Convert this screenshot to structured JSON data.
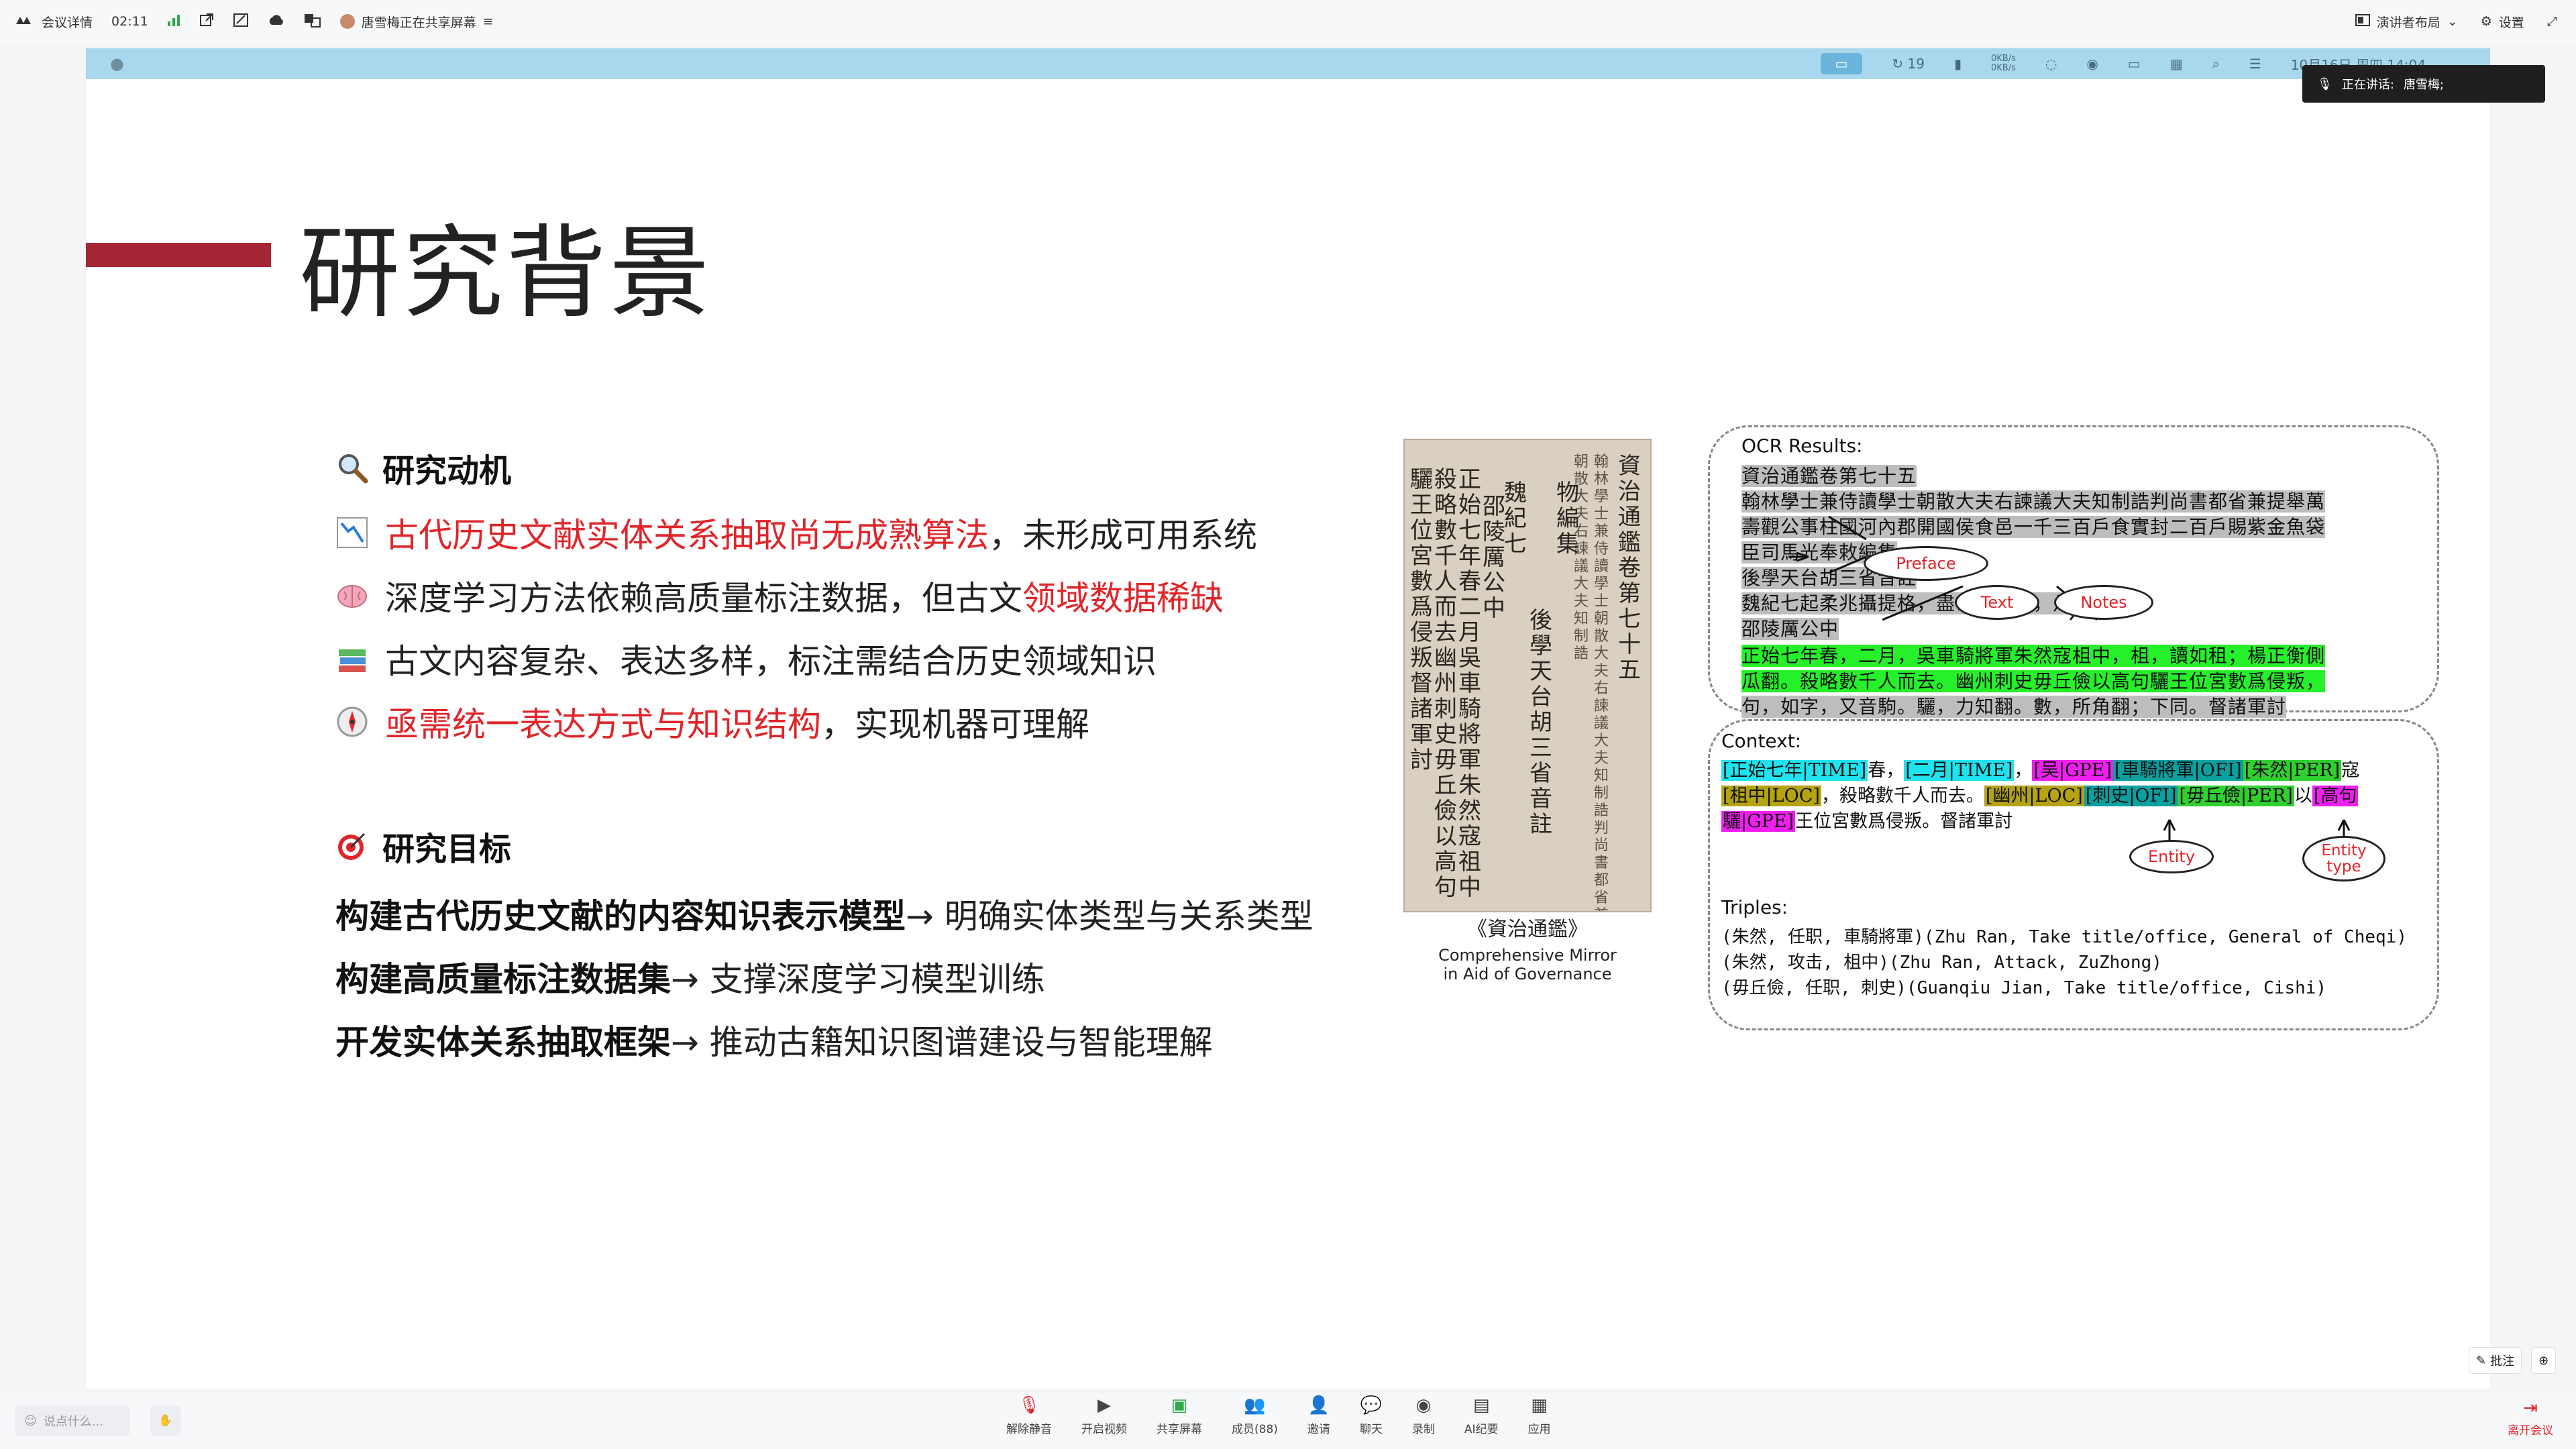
{
  "topbar": {
    "meeting_details": "会议详情",
    "timer": "02:11",
    "sharing_status": "唐雪梅正在共享屏幕",
    "presenter_layout": "演讲者布局",
    "settings": "设置"
  },
  "screen_menubar": {
    "notifications_count": "19",
    "net_up": "0KB/s",
    "net_down": "0KB/s",
    "datetime": "10月16日 周四 14:04"
  },
  "speaker": {
    "label": "正在讲话:",
    "name": "唐雪梅;"
  },
  "slide": {
    "title": "研究背景",
    "motivation": {
      "heading": "研究动机",
      "bullets": [
        {
          "red": "古代历史文献实体关系抽取尚无成熟算法",
          "rest": "，未形成可用系统"
        },
        {
          "pre": "深度学习方法依赖高质量标注数据，但古文",
          "red": "领域数据稀缺"
        },
        {
          "pre": "古文内容复杂、表达多样，标注需结合历史领域知识"
        },
        {
          "red": "亟需统一表达方式与知识结构",
          "rest": "，实现机器可理解"
        }
      ]
    },
    "goals": {
      "heading": "研究目标",
      "items": [
        {
          "bold": "构建古代历史文献的内容知识表示模型",
          "rest": "→ 明确实体类型与关系类型"
        },
        {
          "bold": "构建高质量标注数据集",
          "rest": "→ 支撑深度学习模型训练"
        },
        {
          "bold": "开发实体关系抽取框架",
          "rest": "→ 推动古籍知识图谱建设与智能理解"
        }
      ]
    },
    "figure": {
      "book_caption_cn": "《資治通鑑》",
      "book_caption_en1": "Comprehensive Mirror",
      "book_caption_en2": "in Aid of Governance",
      "book_columns": [
        "資治通鑑卷第七十五",
        "翰林學士兼侍讀學士朝散大夫右諫議大夫知制誥判尚書都省兼提舉萬壽觀公事",
        "朝散大夫右諫議大夫知制誥",
        "物編集",
        "後學天台胡三省音註",
        "魏紀七",
        "邵陵厲公中",
        "正始七年春二月吳車騎將軍朱然寇祖中",
        "殺略數千人而去幽州刺史毋丘儉以高句",
        "驪王位宮數爲侵叛督諸軍討"
      ],
      "ocr": {
        "label": "OCR Results:",
        "lines": [
          "資治通鑑卷第七十五",
          "翰林學士兼侍讀學士朝散大夫右諫議大夫知制誥判尚書都省兼提舉萬",
          "壽觀公事柱國河內郡開國侯食邑一千三百戶食實封二百戶賜紫金魚袋",
          "臣司馬光奉敕編集",
          "後學天台胡三省音註",
          "魏紀七起柔兆攝提格，盡玄黓涒灘，凡七年。",
          "邵陵厲公中",
          "正始七年春，二月，吳車騎將軍朱然寇柤中，柤，讀如租；楊正衡側",
          "瓜翻。殺略數千人而去。幽州刺史毋丘儉以高句驪王位宮數爲侵叛，",
          "句，如字，又音駒。驪，力知翻。數，所角翻；下同。督諸軍討"
        ],
        "annotations": {
          "preface": "Preface",
          "text": "Text",
          "notes": "Notes"
        }
      },
      "context": {
        "label": "Context:",
        "line1": [
          {
            "t": "[正始七年|TIME]",
            "c": "cyan"
          },
          {
            "t": "春，",
            "c": ""
          },
          {
            "t": "[二月|TIME]",
            "c": "cyan"
          },
          {
            "t": "，",
            "c": ""
          },
          {
            "t": "[吴|GPE]",
            "c": "mag"
          },
          {
            "t": "[車騎將軍|OFI]",
            "c": "teal"
          },
          {
            "t": "[朱然|PER]",
            "c": "green"
          },
          {
            "t": "寇",
            "c": ""
          }
        ],
        "line2": [
          {
            "t": "[柤中|LOC]",
            "c": "olive"
          },
          {
            "t": "，殺略數千人而去。",
            "c": ""
          },
          {
            "t": "[幽州|LOC]",
            "c": "olive"
          },
          {
            "t": "[刺史|OFI]",
            "c": "teal"
          },
          {
            "t": "[毋丘儉|PER]",
            "c": "green"
          },
          {
            "t": "以",
            "c": ""
          },
          {
            "t": "[高句",
            "c": "mag"
          }
        ],
        "line3": [
          {
            "t": "驪|GPE]",
            "c": "mag"
          },
          {
            "t": "王位宮數爲侵叛。督諸軍討",
            "c": ""
          }
        ],
        "entity_label": "Entity",
        "entity_type_label": "Entity type"
      },
      "triples": {
        "label": "Triples:",
        "lines": [
          "(朱然, 任职, 車騎將軍)(Zhu Ran, Take title/office, General of Cheqi)",
          "(朱然, 攻击, 柤中)(Zhu Ran, Attack, ZuZhong)",
          "(毋丘儉, 任职, 刺史)(Guanqiu Jian, Take title/office, Cishi)"
        ]
      }
    }
  },
  "annotate": {
    "annotate_label": "批注"
  },
  "bottombar": {
    "input_placeholder": "说点什么...",
    "tools": [
      "解除静音",
      "开启视频",
      "共享屏幕",
      "成员(88)",
      "邀请",
      "聊天",
      "录制",
      "AI纪要",
      "应用"
    ],
    "leave": "离开会议"
  }
}
